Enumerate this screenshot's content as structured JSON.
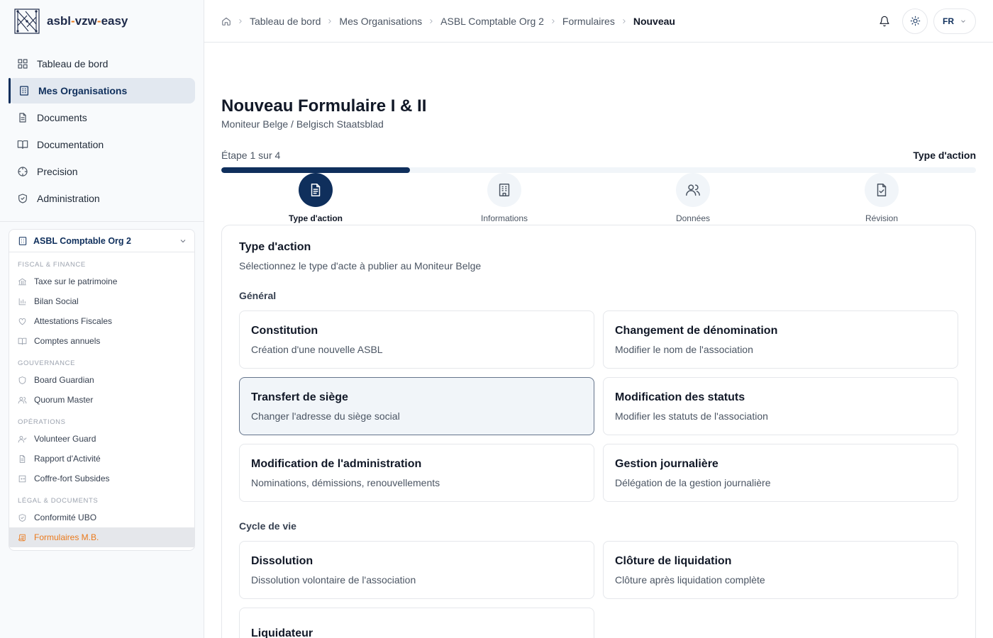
{
  "brand": {
    "name_part1": "asbl",
    "dash1": "-",
    "name_part2": "vzw",
    "dash2": "-",
    "name_part3": "easy"
  },
  "main_nav": [
    {
      "label": "Tableau de bord",
      "icon": "dashboard-icon"
    },
    {
      "label": "Mes Organisations",
      "icon": "building-icon",
      "active": true
    },
    {
      "label": "Documents",
      "icon": "document-icon"
    },
    {
      "label": "Documentation",
      "icon": "book-icon"
    },
    {
      "label": "Precision",
      "icon": "crosshair-icon"
    },
    {
      "label": "Administration",
      "icon": "shield-icon"
    }
  ],
  "org": {
    "name": "ASBL Comptable Org 2",
    "sections": [
      {
        "label": "Fiscal & Finance",
        "items": [
          "Taxe sur le patrimoine",
          "Bilan Social",
          "Attestations Fiscales",
          "Comptes annuels"
        ]
      },
      {
        "label": "Gouvernance",
        "items": [
          "Board Guardian",
          "Quorum Master"
        ]
      },
      {
        "label": "Opérations",
        "items": [
          "Volunteer Guard",
          "Rapport d'Activité",
          "Coffre-fort Subsides"
        ]
      },
      {
        "label": "Légal & Documents",
        "items": [
          "Conformité UBO",
          "Formulaires M.B."
        ]
      }
    ],
    "active_item": "Formulaires M.B."
  },
  "breadcrumb": [
    "Tableau de bord",
    "Mes Organisations",
    "ASBL Comptable Org 2",
    "Formulaires",
    "Nouveau"
  ],
  "topbar": {
    "language": "FR"
  },
  "page": {
    "title": "Nouveau Formulaire I & II",
    "subtitle": "Moniteur Belge / Belgisch Staatsblad",
    "step_info": "Étape 1 sur 4",
    "step_name": "Type d'action",
    "progress_fraction": 0.25
  },
  "steps": [
    {
      "label": "Type d'action",
      "icon": "document-text-icon",
      "active": true
    },
    {
      "label": "Informations",
      "icon": "building-office-icon"
    },
    {
      "label": "Données",
      "icon": "users-icon"
    },
    {
      "label": "Révision",
      "icon": "file-check-icon"
    }
  ],
  "form": {
    "title": "Type d'action",
    "subtitle": "Sélectionnez le type d'acte à publier au Moniteur Belge",
    "groups": [
      {
        "label": "Général",
        "options": [
          {
            "title": "Constitution",
            "desc": "Création d'une nouvelle ASBL"
          },
          {
            "title": "Changement de dénomination",
            "desc": "Modifier le nom de l'association"
          },
          {
            "title": "Transfert de siège",
            "desc": "Changer l'adresse du siège social",
            "selected": true
          },
          {
            "title": "Modification des statuts",
            "desc": "Modifier les statuts de l'association"
          },
          {
            "title": "Modification de l'administration",
            "desc": "Nominations, démissions, renouvellements"
          },
          {
            "title": "Gestion journalière",
            "desc": "Délégation de la gestion journalière"
          }
        ]
      },
      {
        "label": "Cycle de vie",
        "options": [
          {
            "title": "Dissolution",
            "desc": "Dissolution volontaire de l'association"
          },
          {
            "title": "Clôture de liquidation",
            "desc": "Clôture après liquidation complète"
          },
          {
            "title": "Liquidateur",
            "desc": ""
          }
        ]
      }
    ]
  },
  "colors": {
    "primary": "#0f2f5c",
    "accent": "#ea7a1c",
    "sidebar_bg": "#f8fafc"
  }
}
